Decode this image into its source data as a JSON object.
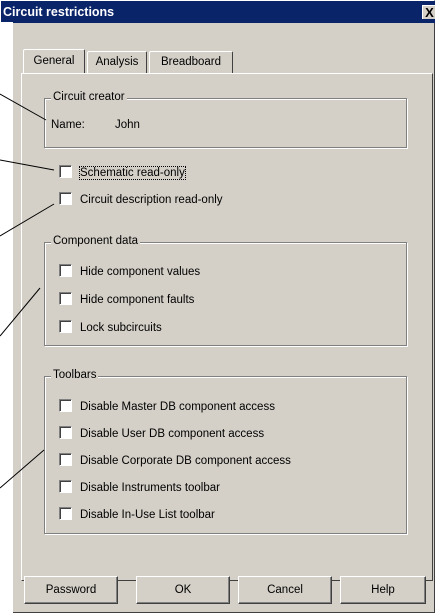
{
  "window": {
    "title": "Circuit restrictions",
    "close_glyph": "X"
  },
  "tabs": [
    {
      "label": "General",
      "active": true
    },
    {
      "label": "Analysis",
      "active": false
    },
    {
      "label": "Breadboard",
      "active": false
    }
  ],
  "creator": {
    "group_title": "Circuit creator",
    "name_label": "Name:",
    "name_value": "John"
  },
  "options": [
    {
      "label": "Schematic read-only",
      "checked": false
    },
    {
      "label": "Circuit description read-only",
      "checked": false
    }
  ],
  "component_data": {
    "group_title": "Component data",
    "items": [
      {
        "label": "Hide component values",
        "checked": false
      },
      {
        "label": "Hide component faults",
        "checked": false
      },
      {
        "label": "Lock subcircuits",
        "checked": false
      }
    ]
  },
  "toolbars": {
    "group_title": "Toolbars",
    "items": [
      {
        "label": "Disable Master DB component access",
        "checked": false
      },
      {
        "label": "Disable User DB component access",
        "checked": false
      },
      {
        "label": "Disable Corporate DB component access",
        "checked": false
      },
      {
        "label": "Disable Instruments toolbar",
        "checked": false
      },
      {
        "label": "Disable In-Use List toolbar",
        "checked": false
      }
    ]
  },
  "buttons": {
    "password": "Password",
    "ok": "OK",
    "cancel": "Cancel",
    "help": "Help"
  },
  "colors": {
    "titlebar": "#0a246a",
    "face": "#d4d0c8"
  }
}
